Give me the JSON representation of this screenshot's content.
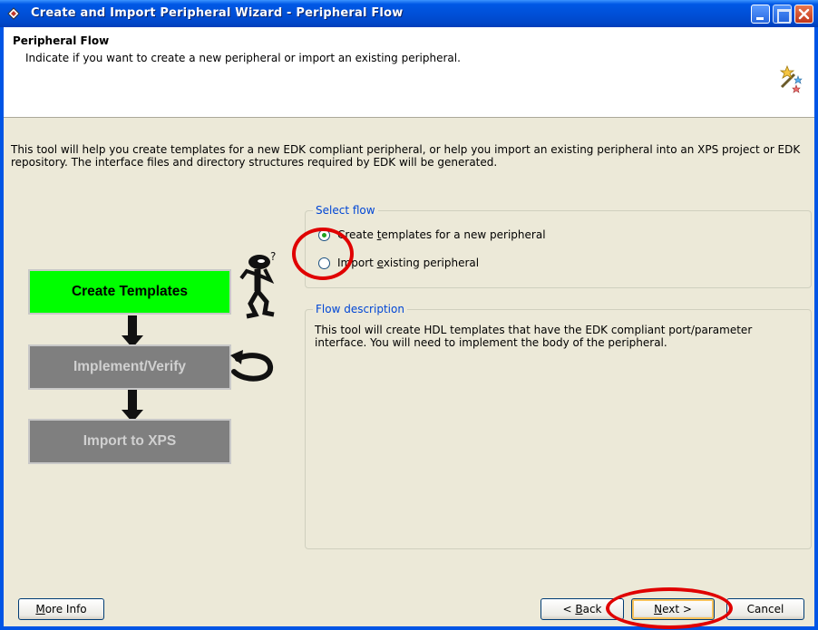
{
  "window": {
    "title": "Create and Import Peripheral Wizard - Peripheral Flow"
  },
  "header": {
    "title": "Peripheral Flow",
    "subtitle": "Indicate if you want to create a new peripheral or import an existing peripheral."
  },
  "intro_text": "This tool will help you create templates for a new EDK compliant peripheral, or help you import an existing peripheral into an XPS project or EDK repository. The interface files and directory structures required by EDK will be generated.",
  "diagram": {
    "steps": [
      "Create Templates",
      "Implement/Verify",
      "Import to XPS"
    ],
    "active_color": "#00ff00",
    "inactive_color": "#7f7f7f"
  },
  "select_flow": {
    "legend": "Select flow",
    "options": [
      {
        "prefix": "Create ",
        "mnemonic": "t",
        "suffix": "emplates for a new peripheral",
        "checked": true
      },
      {
        "prefix": "Import ",
        "mnemonic": "e",
        "suffix": "xisting peripheral",
        "checked": false
      }
    ]
  },
  "flow_description": {
    "legend": "Flow description",
    "text": "This tool will create HDL templates that have the EDK compliant port/parameter interface. You will need to implement the body of the peripheral."
  },
  "buttons": {
    "more_info": {
      "mnemonic": "M",
      "rest": "ore Info"
    },
    "back": {
      "prefix": "< ",
      "mnemonic": "B",
      "rest": "ack"
    },
    "next": {
      "mnemonic": "N",
      "rest": "ext >"
    },
    "cancel": "Cancel"
  },
  "colors": {
    "titlebar": "#0058e6",
    "annotation": "#e00000"
  }
}
